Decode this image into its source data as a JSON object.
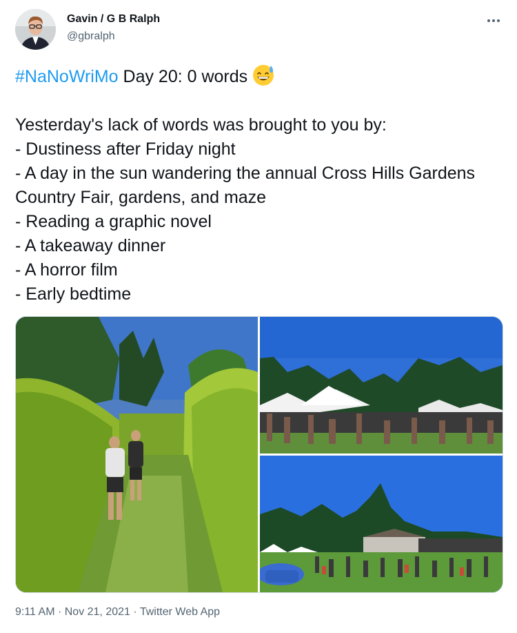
{
  "author": {
    "name": "Gavin / G B Ralph",
    "handle": "@gbralph",
    "avatar_icon": "profile-photo"
  },
  "tweet": {
    "hashtag": "#NaNoWriMo",
    "first_line": " Day 20: 0 words",
    "emoji": "grinning-face-with-sweat",
    "body": "\n\nYesterday's lack of words was brought to you by:\n- Dustiness after Friday night\n- A day in the sun wandering the annual Cross Hills Gardens Country Fair, gardens, and maze\n- Reading a graphic novel\n- A takeaway dinner\n- A horror film\n- Early bedtime"
  },
  "media": {
    "photos": [
      {
        "description_icon": "garden-maze-photo"
      },
      {
        "description_icon": "fair-tents-photo"
      },
      {
        "description_icon": "fair-crowd-photo"
      }
    ]
  },
  "footer": {
    "time": "9:11 AM",
    "date": "Nov 21, 2021",
    "source": "Twitter Web App",
    "separator": " · "
  },
  "colors": {
    "link": "#1d9bf0",
    "text": "#0f1419",
    "secondary": "#536471"
  }
}
